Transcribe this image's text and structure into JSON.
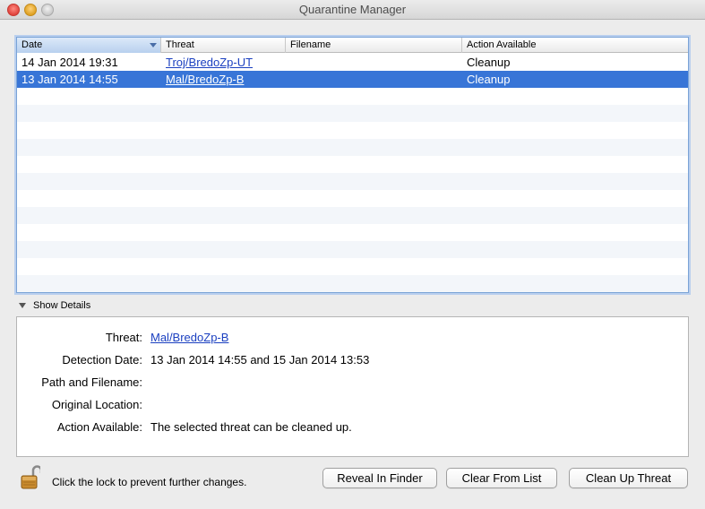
{
  "window": {
    "title": "Quarantine Manager"
  },
  "table": {
    "columns": [
      "Date",
      "Threat",
      "Filename",
      "Action Available"
    ],
    "sorted_column": "Date",
    "rows": [
      {
        "date": "14 Jan 2014 19:31",
        "threat": "Troj/BredoZp-UT",
        "filename": "",
        "action": "Cleanup",
        "selected": false
      },
      {
        "date": "13 Jan 2014 14:55",
        "threat": "Mal/BredoZp-B",
        "filename": "",
        "action": "Cleanup",
        "selected": true
      }
    ],
    "selection_color": "#3875d7",
    "link_color": "#1a3fc0"
  },
  "details": {
    "toggle_label": "Show Details",
    "fields": [
      {
        "label": "Threat:",
        "value": "Mal/BredoZp-B",
        "is_link": true
      },
      {
        "label": "Detection Date:",
        "value": "13 Jan 2014 14:55 and 15 Jan 2014 13:53",
        "is_link": false
      },
      {
        "label": "Path and Filename:",
        "value": "",
        "is_link": false
      },
      {
        "label": "Original Location:",
        "value": "",
        "is_link": false
      },
      {
        "label": "Action Available:",
        "value": "The selected threat can be cleaned up.",
        "is_link": false
      }
    ]
  },
  "footer": {
    "lock_icon": "open-lock-icon",
    "lock_text": "Click the lock to prevent further changes.",
    "buttons": {
      "reveal": "Reveal In Finder",
      "clear": "Clear From List",
      "cleanup": "Clean Up Threat"
    }
  }
}
